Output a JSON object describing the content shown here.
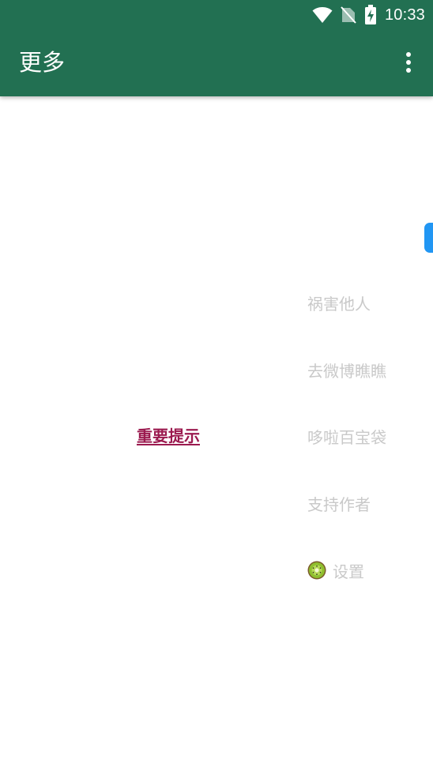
{
  "status_bar": {
    "time": "10:33",
    "icons": [
      "wifi-icon",
      "no-sim-icon",
      "battery-charging-icon"
    ]
  },
  "toolbar": {
    "title": "更多",
    "overflow_icon": "more-vert-icon"
  },
  "content": {
    "notice_link": "重要提示",
    "menu_items": [
      {
        "label": "祸害他人"
      },
      {
        "label": "去微博瞧瞧"
      },
      {
        "label": "哆啦百宝袋"
      },
      {
        "label": "支持作者"
      },
      {
        "label": "设置",
        "icon": "kiwi-icon"
      }
    ],
    "side_tab_icon": "floating-tab"
  },
  "colors": {
    "appbar": "#227052",
    "link": "#9b1a4f",
    "menu_text": "#c9c9c9",
    "side_tab": "#2196f3"
  }
}
